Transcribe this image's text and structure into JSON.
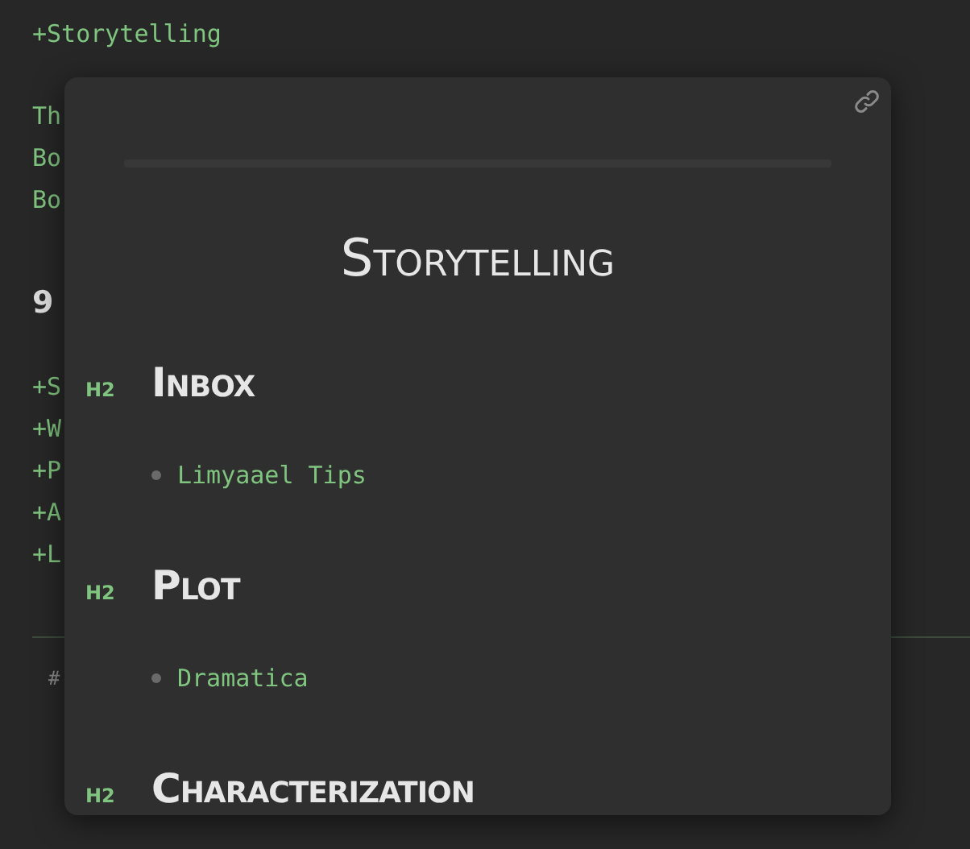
{
  "editor": {
    "title_link": "+Storytelling",
    "lines": [
      "Th",
      "Bo",
      "Bo"
    ],
    "heading": "9",
    "links": [
      "+S",
      "+W",
      "+P",
      "+A",
      "+L"
    ],
    "tag": "#"
  },
  "preview": {
    "title": "Storytelling",
    "sections": [
      {
        "level": "H2",
        "heading": "Inbox",
        "items": [
          "Limyaael Tips"
        ]
      },
      {
        "level": "H2",
        "heading": "Plot",
        "items": [
          "Dramatica"
        ]
      },
      {
        "level": "H2",
        "heading": "Characterization"
      }
    ]
  }
}
